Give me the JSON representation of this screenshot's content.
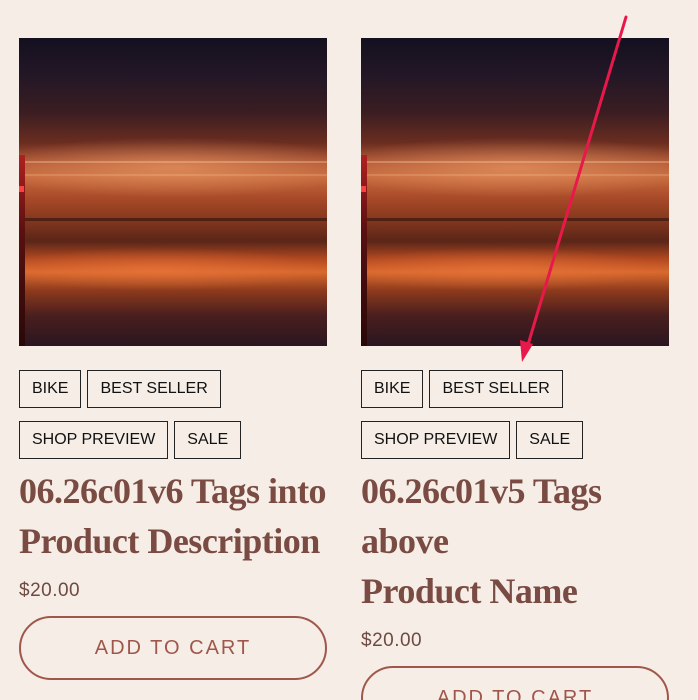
{
  "products": [
    {
      "tags": [
        "BIKE",
        "BEST SELLER",
        "SHOP PREVIEW",
        "SALE"
      ],
      "title_line1": "06.26c01v6 Tags into",
      "title_line2": "Product Description",
      "price": "$20.00",
      "cta": "ADD TO CART"
    },
    {
      "tags": [
        "BIKE",
        "BEST SELLER",
        "SHOP PREVIEW",
        "SALE"
      ],
      "title_line1": "06.26c01v5 Tags above",
      "title_line2": "Product Name",
      "price": "$20.00",
      "cta": "ADD TO CART"
    }
  ],
  "colors": {
    "background": "#f5ede6",
    "title": "#7a4b42",
    "button": "#a0574b",
    "annotation_arrow": "#e8194a"
  },
  "icons": [
    "red-annotation-arrow"
  ]
}
